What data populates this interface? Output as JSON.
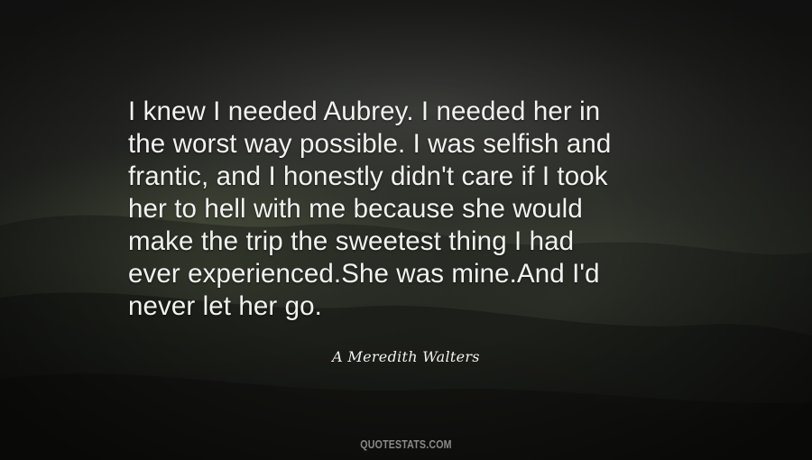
{
  "quote": {
    "lines": [
      "I knew I needed Aubrey. I needed her in",
      "the worst way possible. I was selfish and",
      "frantic, and I honestly didn't care if I took",
      "her to hell with me because she would",
      "make the trip the sweetest thing I had",
      "ever experienced.She was mine.And I'd",
      "never let her go."
    ]
  },
  "author": "A Meredith Walters",
  "watermark": "QUOTESTATS.COM",
  "colors": {
    "text": "#f2f2f0",
    "watermark": "#8a8a86",
    "background": "#262723"
  }
}
